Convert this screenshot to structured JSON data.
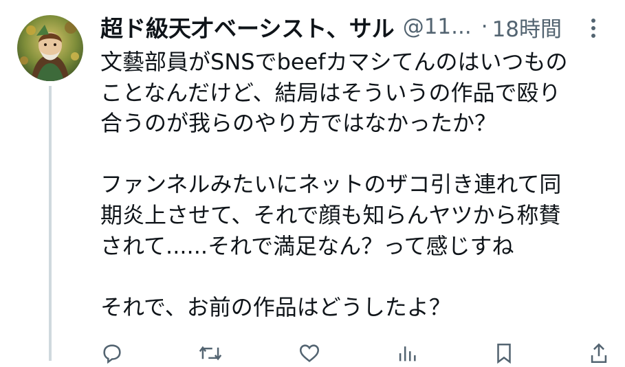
{
  "tweet": {
    "display_name": "超ド級天才ベーシスト、サル",
    "handle": "@11...",
    "separator": "·",
    "timestamp": "18時間",
    "lines": [
      "文藝部員がSNSでbeefカマシてんのはいつもの",
      "ことなんだけど、結局はそういうの作品で殴り",
      "合うのが我らのやり方ではなかったか？",
      "",
      "ファンネルみたいにネットのザコ引き連れて同",
      "期炎上させて、それで顔も知らんヤツから称賛",
      "されて......それで満足なん？って感じすね",
      "",
      "それで、お前の作品はどうしたよ？"
    ]
  },
  "actions": [
    {
      "name": "reply-icon"
    },
    {
      "name": "retweet-icon"
    },
    {
      "name": "like-icon"
    },
    {
      "name": "views-icon"
    },
    {
      "name": "bookmark-icon"
    },
    {
      "name": "share-icon"
    }
  ],
  "colors": {
    "text": "#0f1419",
    "secondary": "#536471",
    "thread_line": "#cfd9de"
  }
}
